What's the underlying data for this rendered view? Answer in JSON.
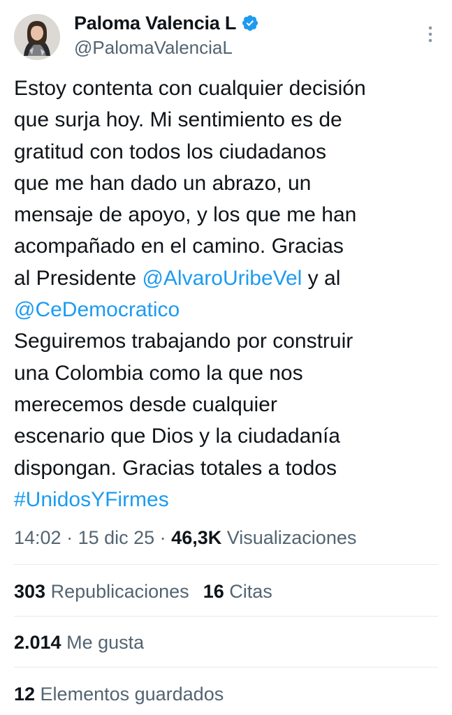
{
  "author": {
    "display_name": "Paloma Valencia L",
    "handle": "@PalomaValenciaL"
  },
  "tweet": {
    "line1": "Estoy contenta con cualquier decisión",
    "line2": "que surja hoy. Mi sentimiento es de",
    "line3": "gratitud con todos los ciudadanos",
    "line4": "que me han dado un abrazo, un",
    "line5": "mensaje de apoyo, y los que me han",
    "line6": "acompañado en el camino. Gracias",
    "line7_pre": "al Presidente ",
    "mention1": "@AlvaroUribeVel",
    "line7_post": " y al",
    "mention2": "@CeDemocratico",
    "line9": "Seguiremos trabajando por construir",
    "line10": "una Colombia como la que nos",
    "line11": "merecemos desde cualquier",
    "line12": "escenario que Dios y la ciudadanía",
    "line13": "dispongan. Gracias totales a todos",
    "hashtag": "#UnidosYFirmes"
  },
  "meta": {
    "time": "14:02",
    "separator": " · ",
    "date": "15 dic 25",
    "views_count": "46,3K",
    "views_label": " Visualizaciones"
  },
  "stats": {
    "reposts_count": "303",
    "reposts_label": " Republicaciones",
    "quotes_count": "16",
    "quotes_label": " Citas",
    "likes_count": "2.014",
    "likes_label": " Me gusta",
    "bookmarks_count": "12",
    "bookmarks_label": " Elementos guardados"
  },
  "colors": {
    "link": "#1d9bf0",
    "verified": "#1d9bf0",
    "secondary_text": "#536471",
    "primary_text": "#0f1419"
  },
  "icons": {
    "verified": "verified-badge-icon",
    "more": "more-options-icon"
  }
}
